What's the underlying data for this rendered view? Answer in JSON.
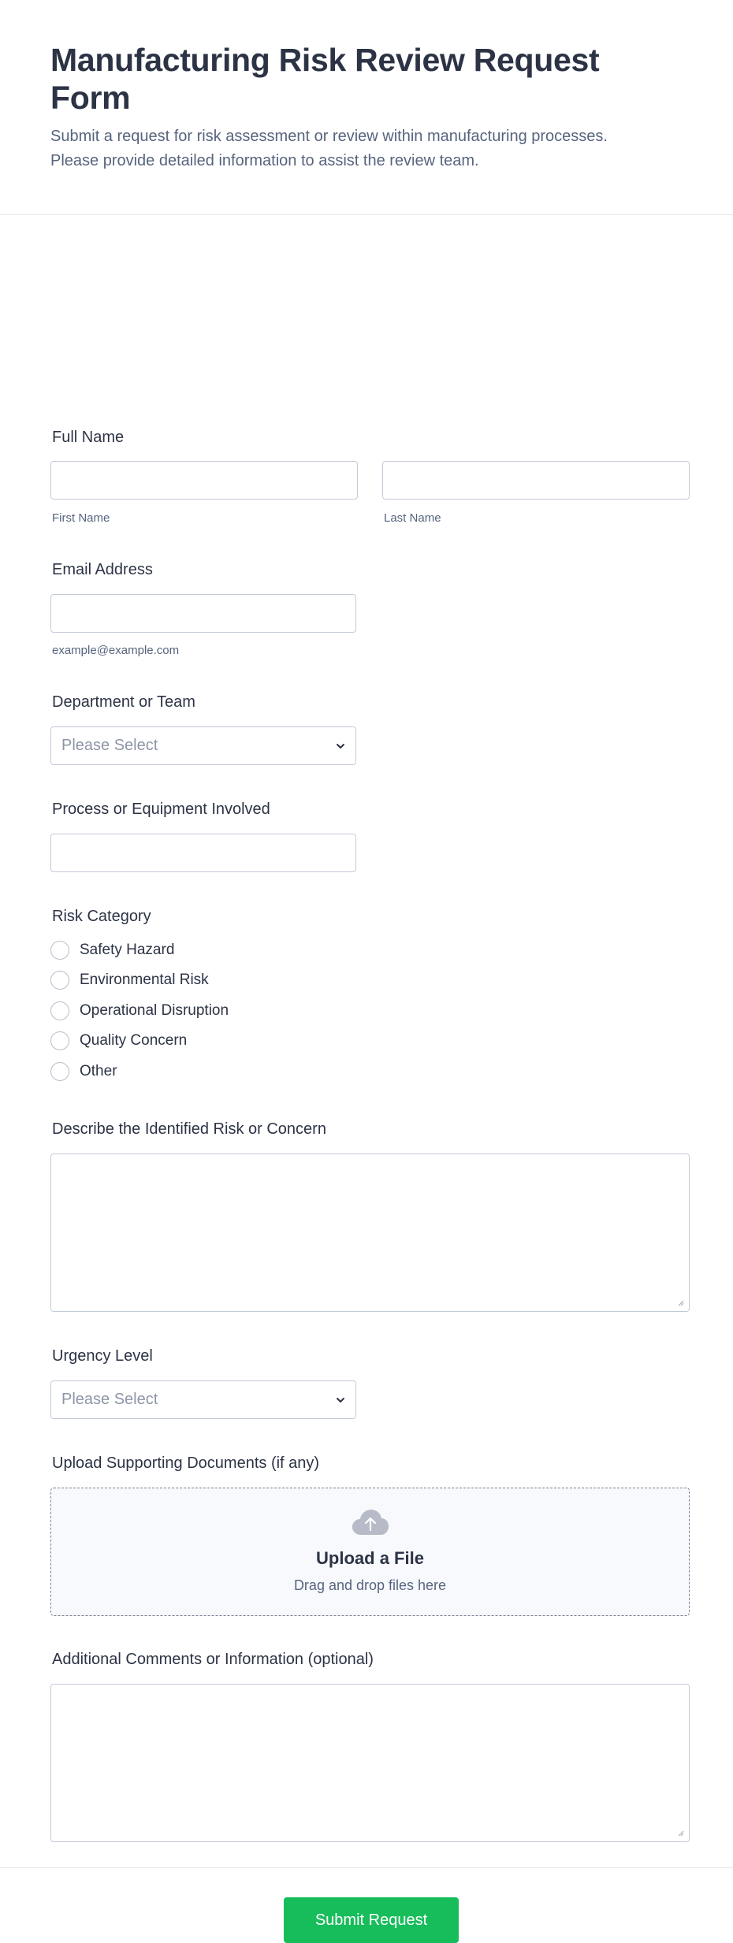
{
  "header": {
    "title": "Manufacturing Risk Review Request Form",
    "subtitle_line1": "Submit a request for risk assessment or review within manufacturing processes.",
    "subtitle_line2": "Please provide detailed information to assist the review team."
  },
  "full_name": {
    "label": "Full Name",
    "first_sublabel": "First Name",
    "last_sublabel": "Last Name",
    "first_value": "",
    "last_value": ""
  },
  "email": {
    "label": "Email Address",
    "sublabel": "example@example.com",
    "value": ""
  },
  "department": {
    "label": "Department or Team",
    "placeholder": "Please Select"
  },
  "process": {
    "label": "Process or Equipment Involved",
    "value": ""
  },
  "risk_category": {
    "label": "Risk Category",
    "options": [
      "Safety Hazard",
      "Environmental Risk",
      "Operational Disruption",
      "Quality Concern",
      "Other"
    ]
  },
  "describe": {
    "label": "Describe the Identified Risk or Concern",
    "value": ""
  },
  "urgency": {
    "label": "Urgency Level",
    "placeholder": "Please Select"
  },
  "upload": {
    "label": "Upload Supporting Documents (if any)",
    "title": "Upload a File",
    "subtitle": "Drag and drop files here",
    "icon": "cloud-upload-icon"
  },
  "comments": {
    "label": "Additional Comments or Information (optional)",
    "value": ""
  },
  "submit": {
    "label": "Submit Request",
    "color": "#18bd5b"
  }
}
